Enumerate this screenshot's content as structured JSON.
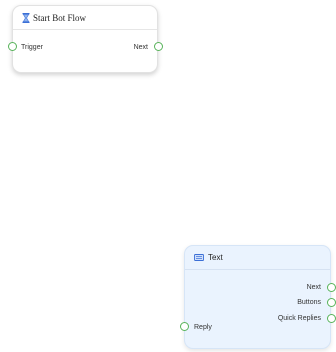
{
  "nodes": {
    "start_flow": {
      "title": "Start Bot Flow",
      "icon": "hourglass-icon",
      "inputs": [
        {
          "label": "Trigger"
        }
      ],
      "outputs": [
        {
          "label": "Next"
        }
      ]
    },
    "text": {
      "title": "Text",
      "icon": "message-icon",
      "outputs": [
        {
          "label": "Next"
        },
        {
          "label": "Buttons"
        },
        {
          "label": "Quick Replies"
        }
      ],
      "inputs": [
        {
          "label": "Reply"
        }
      ]
    }
  },
  "colors": {
    "port_stroke": "#58b35a",
    "text_node_bg": "#eaf3fe",
    "icon_blue": "#3b6fd6"
  }
}
